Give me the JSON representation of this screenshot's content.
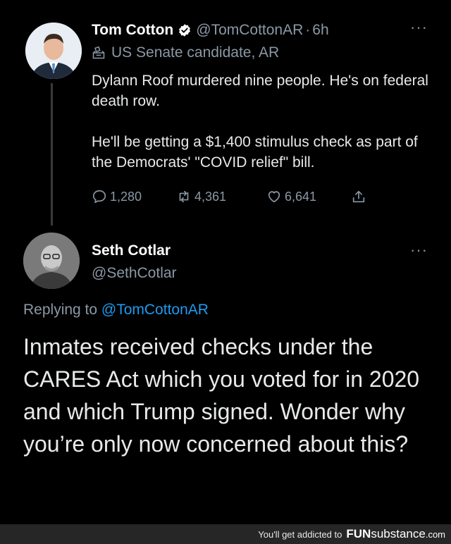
{
  "tweet1": {
    "display_name": "Tom Cotton",
    "handle": "@TomCottonAR",
    "separator": "·",
    "time": "6h",
    "label": "US Senate candidate, AR",
    "text": "Dylann Roof murdered nine people. He's on federal death row.\n\nHe'll be getting a $1,400 stimulus check as part of the Democrats' \"COVID relief\" bill.",
    "reply_count": "1,280",
    "retweet_count": "4,361",
    "like_count": "6,641",
    "more": "···"
  },
  "reply": {
    "display_name": "Seth Cotlar",
    "handle": "@SethCotlar",
    "replying_prefix": "Replying to ",
    "replying_to": "@TomCottonAR",
    "text": "Inmates received checks under the CARES Act which you voted for in 2020 and which Trump signed. Wonder why you’re only now concerned about this?",
    "more": "···"
  },
  "footer": {
    "text": "You'll get addicted to",
    "brand_fun": "FUN",
    "brand_sub": "substance",
    "brand_dom": ".com"
  },
  "colors": {
    "background": "#000000",
    "text": "#e7e9ea",
    "muted": "#8b98a5",
    "link": "#1d9bf0",
    "verified": "#ffffff"
  }
}
